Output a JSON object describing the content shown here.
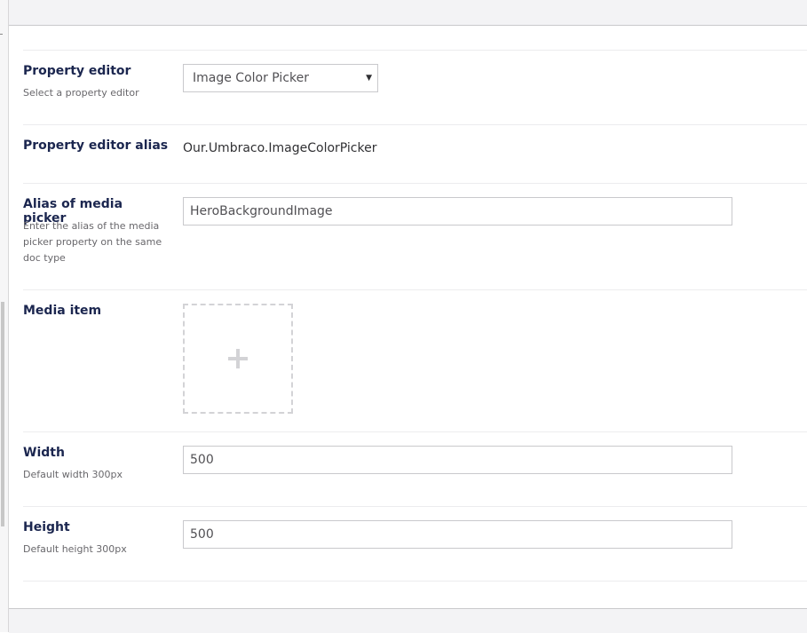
{
  "property_editor": {
    "label": "Property editor",
    "description": "Select a property editor",
    "selected": "Image Color Picker"
  },
  "property_editor_alias": {
    "label": "Property editor alias",
    "value": "Our.Umbraco.ImageColorPicker"
  },
  "alias_media_picker": {
    "label": "Alias of media picker",
    "description": "Enter the alias of the media picker property on the same doc type",
    "value": "HeroBackgroundImage"
  },
  "media_item": {
    "label": "Media item",
    "add_icon": "plus-icon"
  },
  "width": {
    "label": "Width",
    "description": "Default width 300px",
    "value": "500"
  },
  "height": {
    "label": "Height",
    "description": "Default height 300px",
    "value": "500"
  }
}
